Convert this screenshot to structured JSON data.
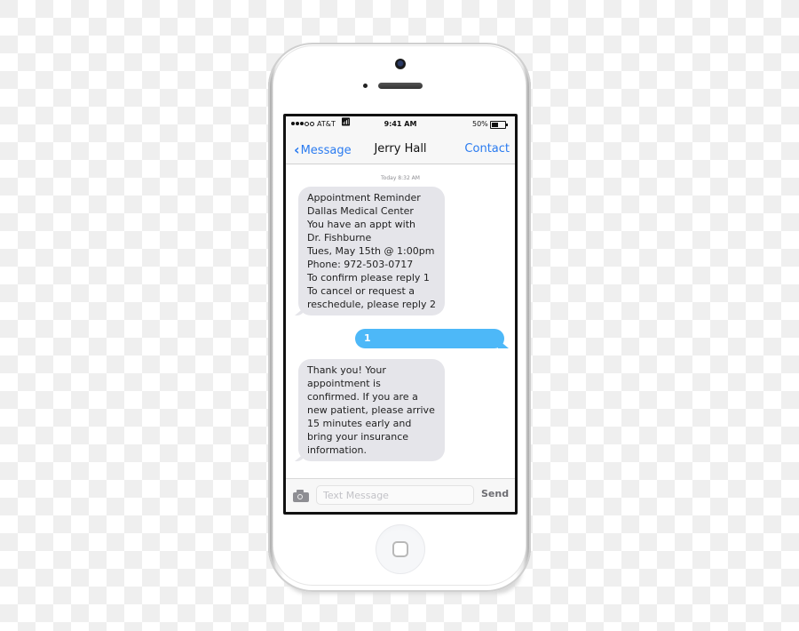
{
  "statusbar": {
    "signal_bars_filled": 3,
    "signal_bars_total": 5,
    "carrier": "AT&T",
    "wifi_icon": "wifi-icon",
    "time": "9:41 AM",
    "battery_percent_label": "50%",
    "battery_level": 0.5
  },
  "navbar": {
    "back_label": "Message",
    "title": "Jerry Hall",
    "contact_label": "Contact"
  },
  "conversation": {
    "timestamp": "Today 8:32 AM",
    "messages": [
      {
        "direction": "incoming",
        "text": "Appointment Reminder\nDallas Medical Center\nYou have an appt with\nDr. Fishburne\nTues, May 15th @ 1:00pm\nPhone: 972-503-0717\nTo confirm please reply 1\nTo cancel or request a\nreschedule, please reply 2"
      },
      {
        "direction": "outgoing",
        "text": "1"
      },
      {
        "direction": "incoming",
        "text": "Thank you! Your\nappointment is\nconfirmed. If you are a\nnew patient, please arrive\n15 minutes early and\nbring your insurance\ninformation."
      }
    ]
  },
  "composer": {
    "camera_icon": "camera-icon",
    "placeholder": "Text Message",
    "value": "",
    "send_label": "Send"
  },
  "colors": {
    "accent_blue": "#2a7bf0",
    "outgoing_bubble": "#4db8f8",
    "incoming_bubble": "#e5e5ea"
  }
}
